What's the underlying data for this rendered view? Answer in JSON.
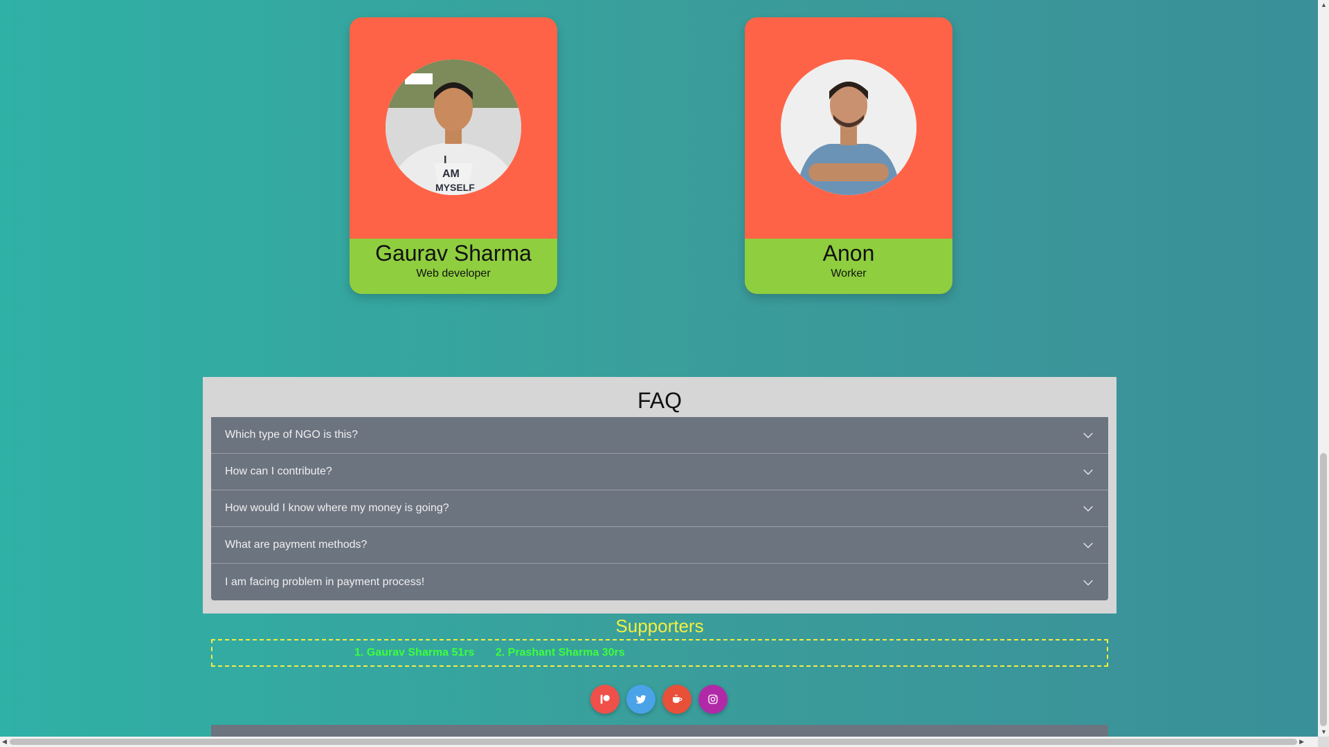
{
  "team": [
    {
      "name": "Gaurav Sharma",
      "role": "Web developer",
      "photo": "person-photo-gaurav"
    },
    {
      "name": "Anon",
      "role": "Worker",
      "photo": "person-photo-anon"
    }
  ],
  "faq": {
    "title": "FAQ",
    "items": [
      {
        "question": "Which type of NGO is this?"
      },
      {
        "question": "How can I contribute?"
      },
      {
        "question": "How would I know where my money is going?"
      },
      {
        "question": "What are payment methods?"
      },
      {
        "question": "I am facing problem in payment process!"
      }
    ]
  },
  "supporters": {
    "title": "Supporters",
    "list": [
      "1. Gaurav Sharma 51rs",
      "2. Prashant Sharma 30rs"
    ]
  },
  "social": [
    {
      "name": "patreon-icon",
      "color": "#f0504a"
    },
    {
      "name": "twitter-icon",
      "color": "#4aa2e8"
    },
    {
      "name": "coffee-icon",
      "color": "#e8503a"
    },
    {
      "name": "instagram-icon",
      "color": "#b02aa8"
    }
  ],
  "colors": {
    "card_top": "#ff6347",
    "card_info": "#8fce3f",
    "faq_bg": "#d6d6d6",
    "faq_item": "#6c7480",
    "supporters_title": "#f5ef3f",
    "supporters_text": "#3cff3c"
  }
}
